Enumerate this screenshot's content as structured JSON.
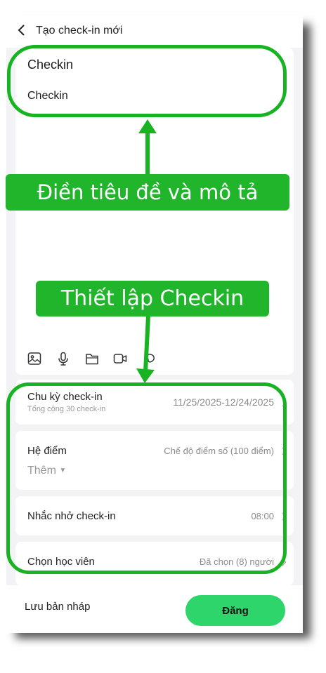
{
  "header": {
    "title": "Tạo check-in mới",
    "back_icon": "chevron-left-icon"
  },
  "editor": {
    "title_value": "Checkin",
    "description_value": "Checkin",
    "toolbar_icons": [
      "image-icon",
      "microphone-icon",
      "folder-icon",
      "video-icon",
      "topic-icon"
    ]
  },
  "settings": {
    "cycle": {
      "label": "Chu kỳ check-in",
      "sub": "Tổng cộng 30 check-in",
      "value": "11/25/2025-12/24/2025"
    },
    "points": {
      "label": "Hệ điểm",
      "value": "Chế độ điểm số (100 điểm)",
      "add_label": "Thêm"
    },
    "reminder": {
      "label": "Nhắc nhở check-in",
      "value": "08:00"
    },
    "students": {
      "label": "Chọn học viên",
      "value": "Đã chọn (8) người"
    }
  },
  "bottom": {
    "draft_label": "Lưu bản nháp",
    "post_label": "Đăng"
  },
  "annotations": {
    "fill_title_desc": "Điền tiêu đề và mô tả",
    "setup_checkin": "Thiết lập Checkin",
    "color": "#17b322"
  },
  "colors": {
    "accent": "#2ed56a",
    "annotation": "#17b322"
  }
}
